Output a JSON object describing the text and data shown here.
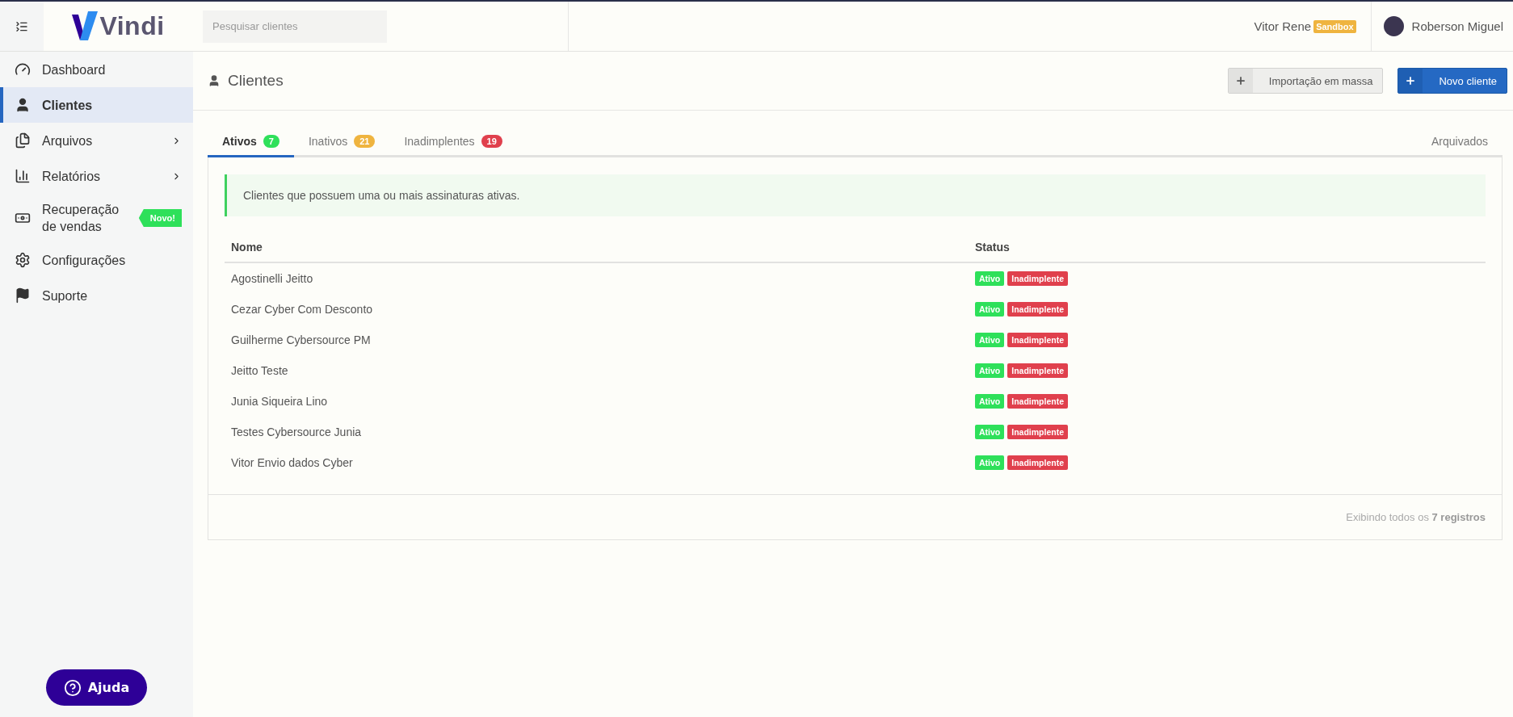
{
  "header": {
    "logo_text": "Vindi",
    "search": {
      "placeholder": "Pesquisar clientes"
    },
    "account": {
      "name": "Vitor Rene",
      "env_badge": "Sandbox"
    },
    "user": {
      "name": "Roberson Miguel"
    }
  },
  "sidebar": {
    "items": [
      {
        "label": "Dashboard",
        "selected": false,
        "expandable": false
      },
      {
        "label": "Clientes",
        "selected": true,
        "expandable": false
      },
      {
        "label": "Arquivos",
        "selected": false,
        "expandable": true
      },
      {
        "label": "Relatórios",
        "selected": false,
        "expandable": true
      },
      {
        "label": "Recuperação de vendas",
        "selected": false,
        "expandable": false,
        "badge": "Novo!"
      },
      {
        "label": "Configurações",
        "selected": false,
        "expandable": false
      },
      {
        "label": "Suporte",
        "selected": false,
        "expandable": false
      }
    ],
    "help_button": "Ajuda"
  },
  "page": {
    "title": "Clientes",
    "actions": [
      {
        "label": "Importação em massa",
        "kind": "secondary"
      },
      {
        "label": "Novo cliente",
        "kind": "primary"
      }
    ]
  },
  "tabs": [
    {
      "label": "Ativos",
      "count": "7",
      "color": "#2ee05a",
      "selected": true
    },
    {
      "label": "Inativos",
      "count": "21",
      "color": "#efb43f",
      "selected": false
    },
    {
      "label": "Inadimplentes",
      "count": "19",
      "color": "#e0404d",
      "selected": false
    }
  ],
  "archived_tab": {
    "label": "Arquivados",
    "selected": false
  },
  "notice": "Clientes que possuem uma ou mais assinaturas ativas.",
  "table": {
    "columns": [
      "Nome",
      "Status"
    ],
    "rows": [
      {
        "name": "Agostinelli Jeitto",
        "status": [
          {
            "label": "Ativo",
            "color": "#2ee05a"
          },
          {
            "label": "Inadimplente",
            "color": "#e0404d"
          }
        ]
      },
      {
        "name": "Cezar Cyber Com Desconto",
        "status": [
          {
            "label": "Ativo",
            "color": "#2ee05a"
          },
          {
            "label": "Inadimplente",
            "color": "#e0404d"
          }
        ]
      },
      {
        "name": "Guilherme Cybersource PM",
        "status": [
          {
            "label": "Ativo",
            "color": "#2ee05a"
          },
          {
            "label": "Inadimplente",
            "color": "#e0404d"
          }
        ]
      },
      {
        "name": "Jeitto Teste",
        "status": [
          {
            "label": "Ativo",
            "color": "#2ee05a"
          },
          {
            "label": "Inadimplente",
            "color": "#e0404d"
          }
        ]
      },
      {
        "name": "Junia Siqueira Lino",
        "status": [
          {
            "label": "Ativo",
            "color": "#2ee05a"
          },
          {
            "label": "Inadimplente",
            "color": "#e0404d"
          }
        ]
      },
      {
        "name": "Testes Cybersource Junia",
        "status": [
          {
            "label": "Ativo",
            "color": "#2ee05a"
          },
          {
            "label": "Inadimplente",
            "color": "#e0404d"
          }
        ]
      },
      {
        "name": "Vitor Envio dados Cyber",
        "status": [
          {
            "label": "Ativo",
            "color": "#2ee05a"
          },
          {
            "label": "Inadimplente",
            "color": "#e0404d"
          }
        ]
      }
    ]
  },
  "footer": "Exibindo todos os **7 registros**"
}
